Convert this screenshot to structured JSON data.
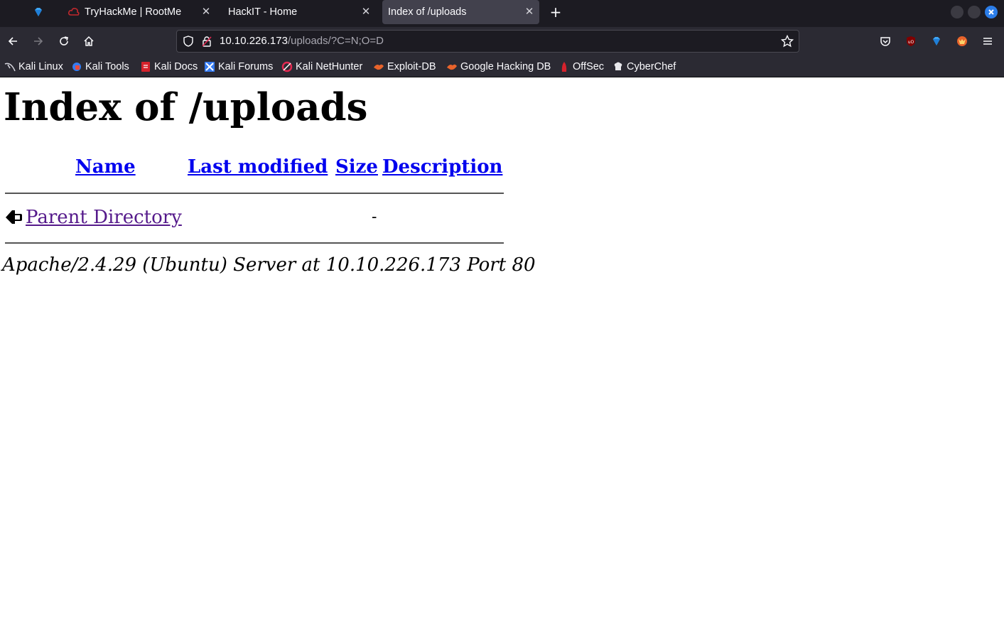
{
  "browser": {
    "tabs": [
      {
        "label": "",
        "favicon": "gem-icon",
        "active": false
      },
      {
        "label": "TryHackMe | RootMe",
        "favicon": "tryhackme-cloud-icon",
        "active": false
      },
      {
        "label": "HackIT - Home",
        "favicon": "",
        "active": false
      },
      {
        "label": "Index of /uploads",
        "favicon": "",
        "active": true
      }
    ],
    "url_host": "10.10.226.173",
    "url_path": "/uploads/?C=N;O=D",
    "bookmarks": [
      {
        "label": "Kali Linux",
        "icon": "kali-dragon-icon"
      },
      {
        "label": "Kali Tools",
        "icon": "kali-tools-icon"
      },
      {
        "label": "Kali Docs",
        "icon": "kali-docs-icon"
      },
      {
        "label": "Kali Forums",
        "icon": "kali-forums-icon"
      },
      {
        "label": "Kali NetHunter",
        "icon": "nethunter-icon"
      },
      {
        "label": "Exploit-DB",
        "icon": "exploit-db-icon"
      },
      {
        "label": "Google Hacking DB",
        "icon": "ghdb-icon"
      },
      {
        "label": "OffSec",
        "icon": "offsec-icon"
      },
      {
        "label": "CyberChef",
        "icon": "cyberchef-icon"
      }
    ],
    "colors": {
      "chrome_dark": "#1c1b22",
      "chrome": "#2b2a33",
      "active_tab": "#42414d",
      "link": "#0000ee",
      "visited": "#551a8b"
    }
  },
  "page": {
    "title": "Index of /uploads",
    "columns": {
      "name": "Name",
      "last_modified": "Last modified",
      "size": "Size",
      "description": "Description"
    },
    "parent": {
      "label": "Parent Directory",
      "size": "-"
    },
    "address": "Apache/2.4.29 (Ubuntu) Server at 10.10.226.173 Port 80"
  }
}
